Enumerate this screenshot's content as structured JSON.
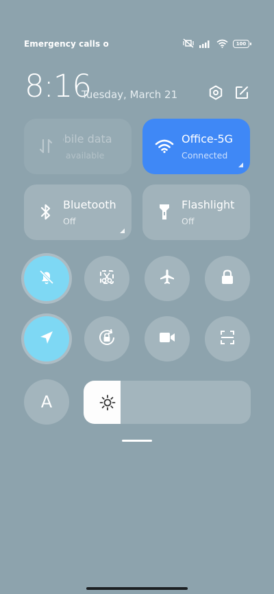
{
  "status_bar": {
    "carrier_text": "Emergency calls o",
    "battery_level": "100",
    "icons": [
      "mute-vibrate-icon",
      "signal-icon",
      "wifi-icon",
      "battery-icon"
    ]
  },
  "header": {
    "time": "8:16",
    "date": "Tuesday, March 21",
    "settings_icon": "settings-hex-icon",
    "edit_icon": "edit-icon"
  },
  "tiles": {
    "mobile_data": {
      "title": "Mobile data",
      "subtitle": "Not available",
      "enabled": false
    },
    "wifi": {
      "title": "Office-5G",
      "subtitle": "Connected",
      "active": true
    },
    "bluetooth": {
      "title": "Bluetooth",
      "subtitle": "Off",
      "active": false
    },
    "flashlight": {
      "title": "Flashlight",
      "subtitle": "Off",
      "active": false
    }
  },
  "toggles": [
    {
      "name": "mute",
      "icon": "bell-off-icon",
      "active": true
    },
    {
      "name": "screenshot",
      "icon": "screenshot-scissors-icon",
      "active": false
    },
    {
      "name": "airplane-mode",
      "icon": "airplane-icon",
      "active": false
    },
    {
      "name": "lock-screen",
      "icon": "lock-icon",
      "active": false
    },
    {
      "name": "location",
      "icon": "location-arrow-icon",
      "active": true
    },
    {
      "name": "rotation-lock",
      "icon": "rotation-lock-icon",
      "active": false
    },
    {
      "name": "screen-recorder",
      "icon": "video-camera-icon",
      "active": false
    },
    {
      "name": "scanner",
      "icon": "scan-icon",
      "active": false
    }
  ],
  "font_button": {
    "label": "A"
  },
  "brightness": {
    "level_fraction": 0.22
  },
  "colors": {
    "background": "#8da3ad",
    "accent_blue": "#3f88f6",
    "active_cyan": "#7ed8f4"
  }
}
